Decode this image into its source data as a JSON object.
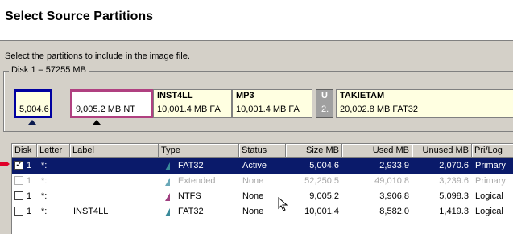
{
  "header": {
    "title": "Select Source Partitions"
  },
  "instruction": "Select the partitions to include in the image file.",
  "disk_group": {
    "legend": "Disk 1 – 57255  MB"
  },
  "partitions": [
    {
      "name": "",
      "info": "5,004.6"
    },
    {
      "name": "",
      "info": "9,005.2 MB NT"
    },
    {
      "name": "INST4LL",
      "info": "10,001.4 MB FA"
    },
    {
      "name": "MP3",
      "info": "10,001.4 MB FA"
    },
    {
      "name": "U",
      "info": "2."
    },
    {
      "name": "TAKIETAM",
      "info": "20,002.8 MB FAT32"
    }
  ],
  "table": {
    "columns": [
      "Disk",
      "Letter",
      "Label",
      "Type",
      "Status",
      "Size MB",
      "Used MB",
      "Unused MB",
      "Pri/Log"
    ],
    "rows": [
      {
        "checked": "✓",
        "disk": "1",
        "letter": "*:",
        "label": "",
        "type": "FAT32",
        "status": "Active",
        "size": "5,004.6",
        "used": "2,933.9",
        "unused": "2,070.6",
        "prilog": "Primary"
      },
      {
        "checked": "",
        "disk": "1",
        "letter": "*:",
        "label": "",
        "type": "Extended",
        "status": "None",
        "size": "52,250.5",
        "used": "49,010.8",
        "unused": "3,239.6",
        "prilog": "Primary"
      },
      {
        "checked": "",
        "disk": "1",
        "letter": "*:",
        "label": "",
        "type": "NTFS",
        "status": "None",
        "size": "9,005.2",
        "used": "3,906.8",
        "unused": "5,098.3",
        "prilog": "Logical"
      },
      {
        "checked": "",
        "disk": "1",
        "letter": "*:",
        "label": "INST4LL",
        "type": "FAT32",
        "status": "None",
        "size": "10,001.4",
        "used": "8,582.0",
        "unused": "1,419.3",
        "prilog": "Logical"
      }
    ]
  },
  "colors": {
    "selection": "#0a1a6a",
    "pointer_arrow": "#e0002a",
    "fat32": "#3a8a9a",
    "ntfs": "#a04080"
  }
}
